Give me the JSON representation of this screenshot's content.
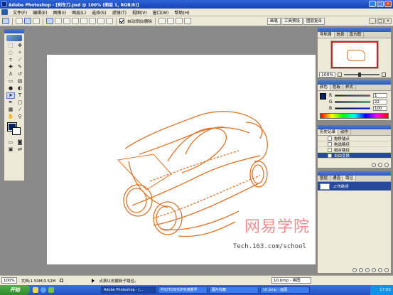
{
  "window": {
    "title": "Adobe Photoshop - [刹车刀.psd @ 100% (图层 1, RGB/8)]",
    "controls": [
      "_",
      "□",
      "×"
    ]
  },
  "menu": {
    "items": [
      "文件(F)",
      "编辑(E)",
      "图像(I)",
      "图层(L)",
      "选择(S)",
      "滤镜(T)",
      "视图(V)",
      "窗口(W)",
      "帮助(H)"
    ]
  },
  "options": {
    "auto_add_label": "自动添加/删除",
    "well_tabs": [
      "画笔",
      "工具预设",
      "图层复合"
    ]
  },
  "navigator": {
    "tabs": [
      "导航器",
      "信息",
      "直方图"
    ],
    "zoom": "100%"
  },
  "color_panel": {
    "tabs": [
      "颜色",
      "色板",
      "样式"
    ],
    "channels": [
      {
        "label": "R",
        "value": "1",
        "color": "#c0282a"
      },
      {
        "label": "G",
        "value": "22",
        "color": "#2c8a2c"
      },
      {
        "label": "B",
        "value": "100",
        "color": "#2438b0"
      }
    ]
  },
  "history": {
    "tabs": [
      "历史记录",
      "动作"
    ],
    "items": [
      "拖移锚点",
      "拖选路径",
      "组合路径",
      "自由变换"
    ],
    "active_index": 3
  },
  "layers": {
    "tabs": [
      "图层",
      "通道",
      "路径"
    ],
    "items": [
      {
        "name": "工作路径"
      }
    ]
  },
  "status": {
    "zoom": "100%",
    "doc_size": "文档:1.50M/3.52M",
    "hint": "点按以创建新子路径。",
    "right_box": "10.bmp - 画图"
  },
  "watermark": {
    "brand": "网易学院",
    "url": "Tech.163.com/school"
  },
  "taskbar": {
    "start_label": "开始",
    "items": [
      "Adobe Photoshop - [...",
      "PHOTOSHOP实用教学",
      "图片收藏",
      "10.bmp - 画图"
    ],
    "active_index": 0,
    "clock": "17:02"
  },
  "colors": {
    "accent_blue": "#2c63d6",
    "sketch_orange": "#e0742a",
    "foreground_swatch": "#002464",
    "watermark_red": "#e8686a"
  }
}
